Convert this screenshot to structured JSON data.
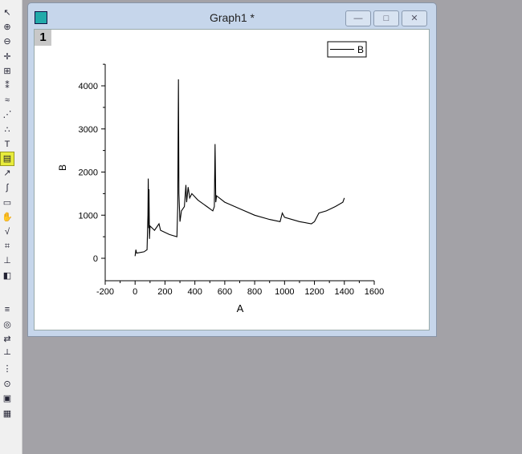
{
  "window": {
    "title": "Graph1 *",
    "layer": "1",
    "minimize": "—",
    "maximize": "□",
    "close": "✕"
  },
  "toolbar": [
    "pointer-icon",
    "zoom-in-icon",
    "zoom-out-icon",
    "screen-reader-icon",
    "data-selector-icon",
    "data-reader-icon",
    "mask-icon",
    "draw-data-icon",
    "scatter-points-icon",
    "text-tool-icon",
    "legend-add-icon",
    "arrow-tool-icon",
    "curve-tool-icon",
    "rectangle-tool-icon",
    "pan-hand-icon",
    "insert-equation-icon",
    "insert-graph-icon",
    "layer-tool-icon",
    "3d-object-icon",
    "color-palette-icon",
    "rotate-icon",
    "merge-icon",
    "axis-icon",
    "worksheet-icon",
    "data-plot-icon",
    "folder-icon",
    "table-icon"
  ],
  "chart_data": {
    "type": "line",
    "xlabel": "A",
    "ylabel": "B",
    "xlim": [
      -200,
      1600
    ],
    "ylim": [
      -500,
      4500
    ],
    "xticks": [
      "-200",
      "0",
      "200",
      "400",
      "600",
      "800",
      "1000",
      "1200",
      "1400",
      "1600"
    ],
    "yticks": [
      "0",
      "1000",
      "2000",
      "3000",
      "4000"
    ],
    "legend": {
      "position": "top-right",
      "entries": [
        "B"
      ]
    },
    "series": [
      {
        "name": "B",
        "color": "#000000",
        "x": [
          0,
          5,
          10,
          60,
          80,
          86,
          88,
          91,
          93,
          96,
          100,
          130,
          160,
          170,
          230,
          280,
          285,
          290,
          293,
          300,
          310,
          330,
          340,
          345,
          355,
          365,
          380,
          420,
          480,
          520,
          530,
          535,
          540,
          545,
          600,
          700,
          800,
          900,
          970,
          985,
          1000,
          1100,
          1180,
          1200,
          1230,
          1280,
          1340,
          1390,
          1400
        ],
        "y": [
          50,
          200,
          120,
          150,
          200,
          1000,
          1850,
          700,
          1600,
          450,
          750,
          650,
          800,
          650,
          550,
          500,
          1200,
          4150,
          1500,
          850,
          1100,
          1200,
          1700,
          1300,
          1650,
          1400,
          1500,
          1350,
          1200,
          1100,
          1200,
          2650,
          1300,
          1450,
          1300,
          1150,
          1000,
          900,
          850,
          1050,
          950,
          850,
          800,
          850,
          1050,
          1100,
          1200,
          1300,
          1400
        ]
      }
    ]
  }
}
